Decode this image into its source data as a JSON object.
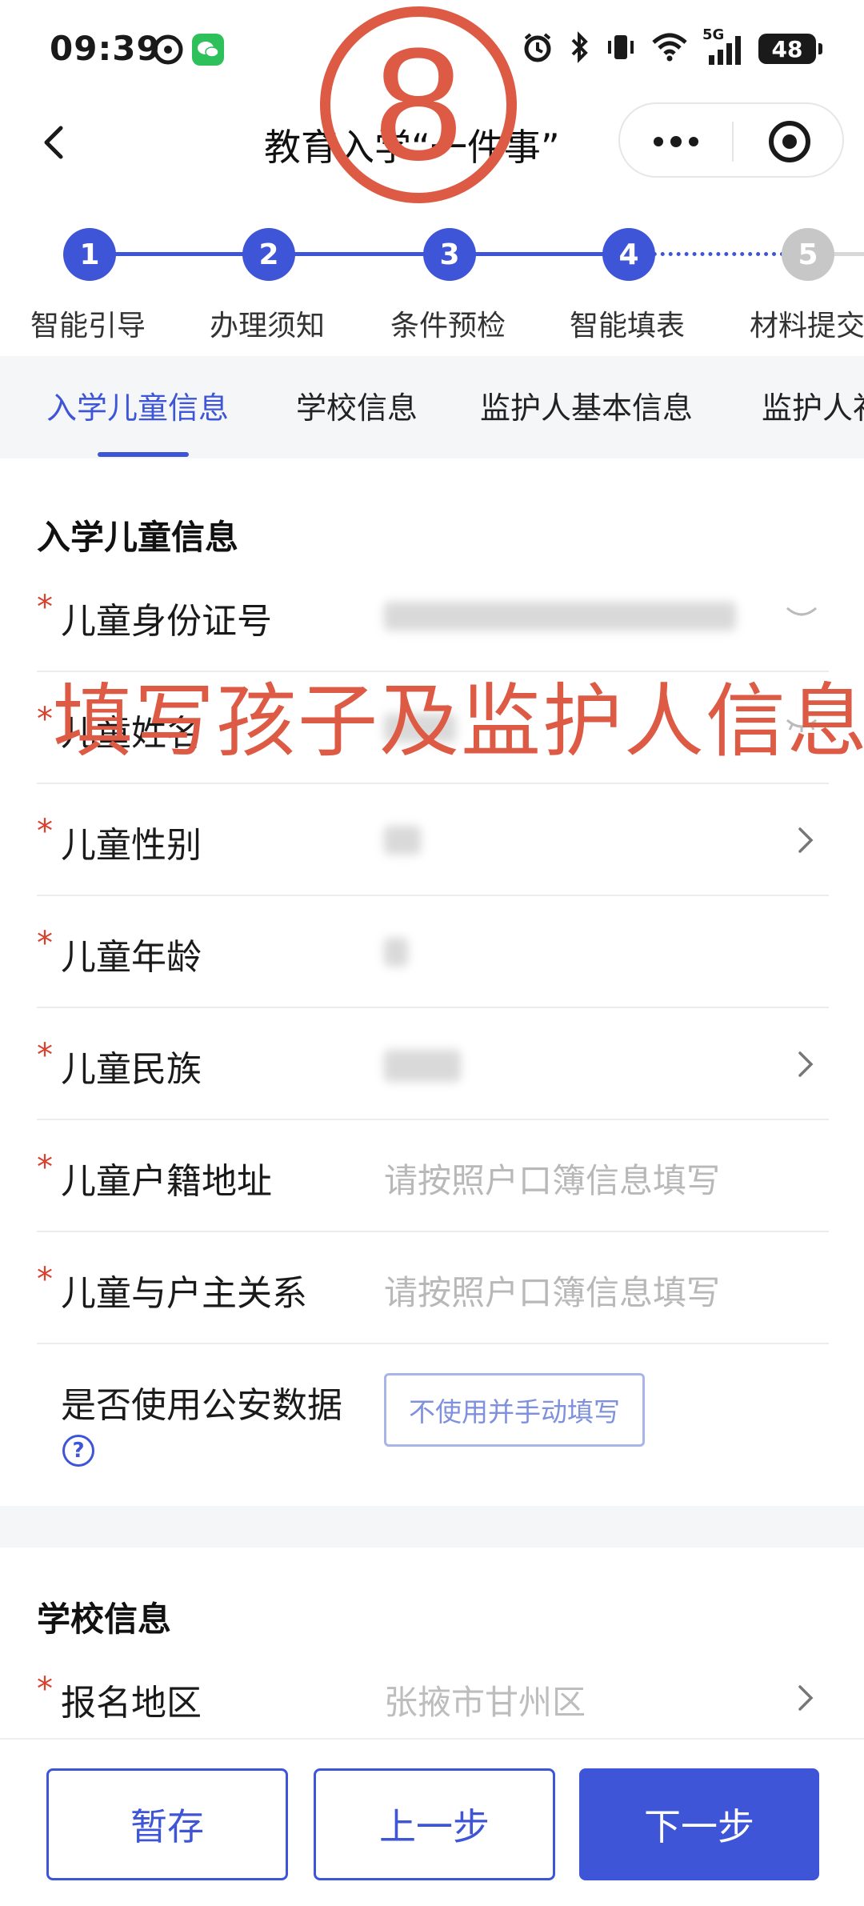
{
  "status_bar": {
    "time": "09:39",
    "battery": "48",
    "network_label": "5G",
    "icons": [
      "alarm-icon",
      "bluetooth-icon",
      "vibrate-icon",
      "wifi-icon",
      "signal-icon",
      "battery-icon"
    ]
  },
  "nav": {
    "title": "教育入学“一件事”",
    "more_icon": "more-dots-icon",
    "close_icon": "target-close-icon",
    "back_icon": "chevron-left-icon"
  },
  "overlay": {
    "step_number": "8",
    "caption": "填写孩子及监护人信息",
    "color": "#dd5a45"
  },
  "steps": [
    {
      "num": "1",
      "label": "智能引导",
      "state": "done"
    },
    {
      "num": "2",
      "label": "办理须知",
      "state": "done"
    },
    {
      "num": "3",
      "label": "条件预检",
      "state": "done"
    },
    {
      "num": "4",
      "label": "智能填表",
      "state": "current"
    },
    {
      "num": "5",
      "label": "材料提交",
      "state": "pending"
    }
  ],
  "tabs": [
    {
      "label": "入学儿童信息",
      "active": true
    },
    {
      "label": "学校信息",
      "active": false
    },
    {
      "label": "监护人基本信息",
      "active": false
    },
    {
      "label": "监护人补充信息",
      "active": false
    }
  ],
  "child_section": {
    "title": "入学儿童信息",
    "fields": [
      {
        "label": "儿童身份证号",
        "required": true,
        "value": "",
        "placeholder": ""
      },
      {
        "label": "儿童姓名",
        "required": true,
        "value": "",
        "placeholder": ""
      },
      {
        "label": "儿童性别",
        "required": true,
        "value": "",
        "placeholder": ""
      },
      {
        "label": "儿童年龄",
        "required": true,
        "value": "",
        "placeholder": ""
      },
      {
        "label": "儿童民族",
        "required": true,
        "value": "",
        "placeholder": ""
      },
      {
        "label": "儿童户籍地址",
        "required": true,
        "value": "",
        "placeholder": "请按照户口簿信息填写"
      },
      {
        "label": "儿童与户主关系",
        "required": true,
        "value": "",
        "placeholder": "请按照户口簿信息填写"
      },
      {
        "label": "是否使用公安数据",
        "required": false,
        "button": "不使用并手动填写"
      }
    ]
  },
  "school_section": {
    "title": "学校信息",
    "fields": [
      {
        "label": "报名地区",
        "required": true,
        "value": "张掖市甘州区"
      }
    ]
  },
  "required_mark": "*",
  "help_mark": "?",
  "bottom": {
    "save_label": "暂存",
    "prev_label": "上一步",
    "next_label": "下一步"
  },
  "colors": {
    "primary": "#3d55d6",
    "required": "#d8412f",
    "annotation": "#dd5a45"
  }
}
